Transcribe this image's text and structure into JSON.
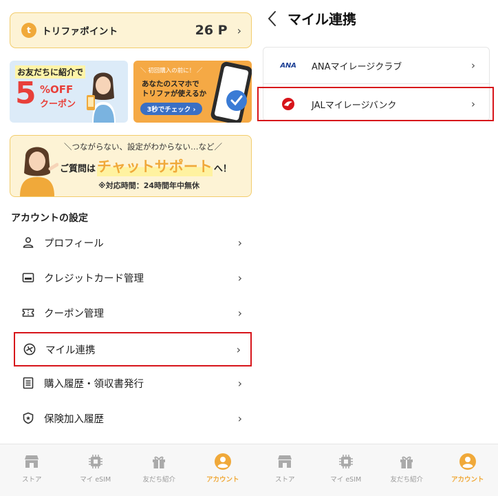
{
  "left_screen": {
    "points_card": {
      "badge": "t",
      "label": "トリファポイント",
      "value": "26 P"
    },
    "invite_banner": {
      "title": "お友だちに紹介で",
      "big_number": "5",
      "off_text": "%OFF",
      "coupon_text": "クーポン"
    },
    "phone_banner": {
      "note": "＼ 初回購入の前に！ ／",
      "line1": "あなたのスマホで",
      "line2": "トリファが使えるか",
      "button": "3秒でチェック ›"
    },
    "chat_banner": {
      "line1": "＼つながらない、設定がわからない…など／",
      "prefix": "ご質問は",
      "highlight": "チャットサポート",
      "suffix": "へ！",
      "hours": "※対応時間：24時間年中無休"
    },
    "section_title": "アカウントの設定",
    "menu_items": [
      {
        "label": "プロフィール",
        "icon": "person-icon"
      },
      {
        "label": "クレジットカード管理",
        "icon": "credit-card-icon"
      },
      {
        "label": "クーポン管理",
        "icon": "ticket-icon"
      },
      {
        "label": "マイル連携",
        "icon": "airplane-icon",
        "highlighted": true
      },
      {
        "label": "購入履歴・領収書発行",
        "icon": "receipt-icon"
      },
      {
        "label": "保険加入履歴",
        "icon": "shield-icon"
      }
    ]
  },
  "tabbar": [
    {
      "label": "ストア",
      "icon": "store-icon"
    },
    {
      "label": "マイ eSIM",
      "icon": "chip-icon"
    },
    {
      "label": "友だち紹介",
      "icon": "gift-icon"
    },
    {
      "label": "アカウント",
      "icon": "account-icon",
      "active": true
    }
  ],
  "right_screen": {
    "title": "マイル連携",
    "programs": [
      {
        "logo_text": "ANA",
        "label": "ANAマイレージクラブ"
      },
      {
        "logo_text": "",
        "label": "JALマイレージバンク",
        "highlighted": true
      }
    ]
  },
  "colors": {
    "accent": "#f0a93a",
    "highlight_border": "#d7141a",
    "card_bg": "#fdf3d5"
  }
}
